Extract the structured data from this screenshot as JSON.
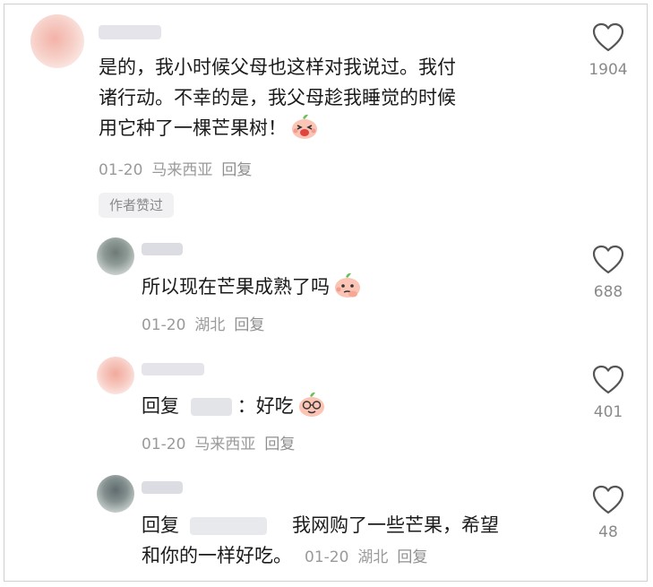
{
  "comments": [
    {
      "text_lines": [
        "是的，我小时候父母也这样对我说过。我付",
        "诸行动。不幸的是，我父母趁我睡觉的时候",
        "用它种了一棵芒果树！"
      ],
      "date": "01-20",
      "location": "马来西亚",
      "reply_label": "回复",
      "badge": "作者赞过",
      "likes": "1904",
      "emoji": "peach-laughing-emoji"
    },
    {
      "text": "所以现在芒果成熟了吗",
      "date": "01-20",
      "location": "湖北",
      "reply_label": "回复",
      "likes": "688",
      "emoji": "peach-thinking-emoji"
    },
    {
      "reply_prefix": "回复",
      "reply_suffix": "：",
      "text": "好吃",
      "date": "01-20",
      "location": "马来西亚",
      "reply_label": "回复",
      "likes": "401",
      "emoji": "peach-glasses-emoji"
    },
    {
      "reply_prefix": "回复",
      "text_line1": "我网购了一些芒果，希望",
      "text_line2": "和你的一样好吃。",
      "date": "01-20",
      "location": "湖北",
      "reply_label": "回复",
      "likes": "48"
    }
  ],
  "icons": {
    "like": "heart-outline-icon"
  },
  "colors": {
    "text": "#1b1b1b",
    "meta": "#9a9a9a",
    "badge_bg": "#f1f1f3"
  }
}
